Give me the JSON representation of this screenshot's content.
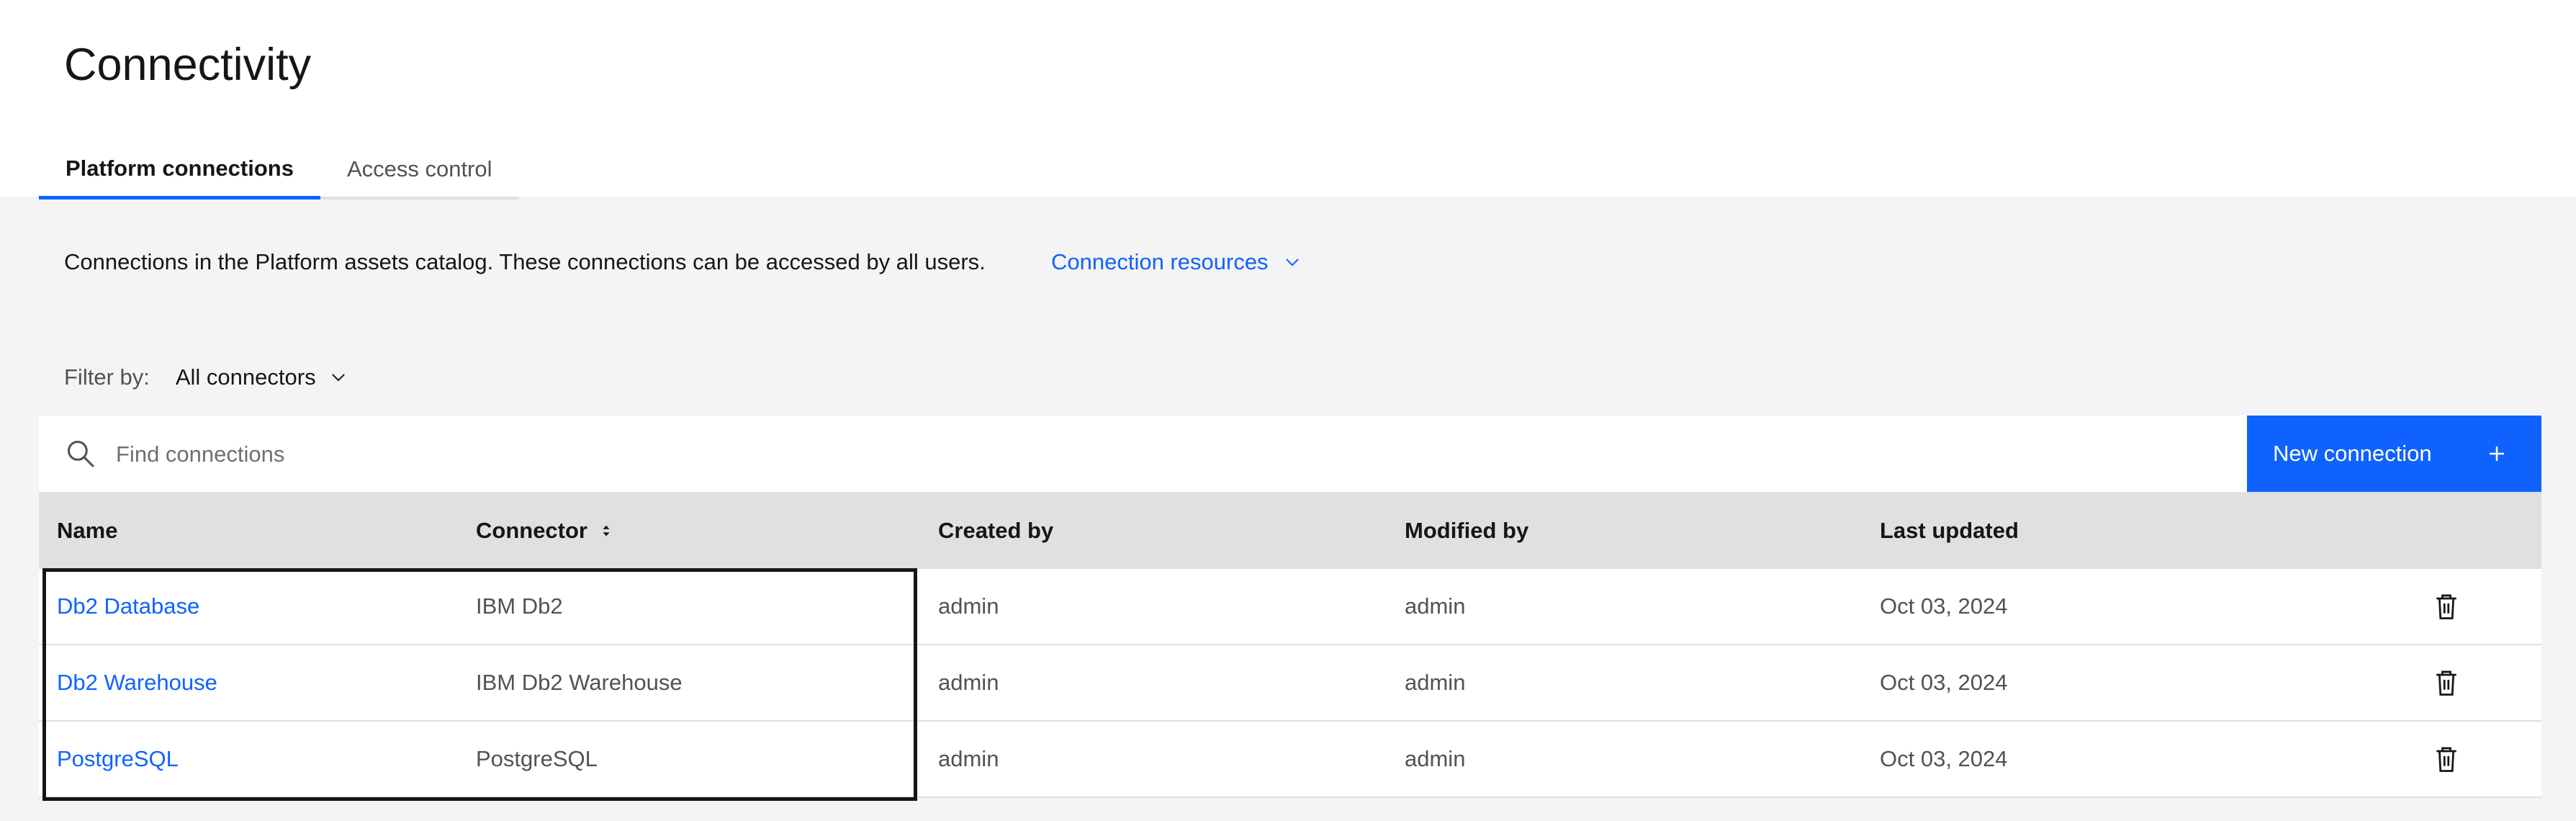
{
  "page": {
    "title": "Connectivity"
  },
  "tabs": [
    {
      "label": "Platform connections",
      "active": true
    },
    {
      "label": "Access control",
      "active": false
    }
  ],
  "description": "Connections in the Platform assets catalog. These connections can be accessed by all users.",
  "resources_link": {
    "label": "Connection resources",
    "icon": "chevron-down-icon"
  },
  "filter": {
    "label": "Filter by:",
    "value": "All connectors",
    "icon": "chevron-down-icon"
  },
  "search": {
    "placeholder": "Find connections",
    "value": "",
    "icon": "search-icon"
  },
  "new_button": {
    "label": "New connection",
    "icon": "plus-icon"
  },
  "table": {
    "columns": [
      "Name",
      "Connector",
      "Created by",
      "Modified by",
      "Last updated"
    ],
    "sortable_column": "Connector",
    "rows": [
      {
        "name": "Db2 Database",
        "connector": "IBM Db2",
        "created_by": "admin",
        "modified_by": "admin",
        "last_updated": "Oct 03, 2024"
      },
      {
        "name": "Db2 Warehouse",
        "connector": "IBM Db2 Warehouse",
        "created_by": "admin",
        "modified_by": "admin",
        "last_updated": "Oct 03, 2024"
      },
      {
        "name": "PostgreSQL",
        "connector": "PostgreSQL",
        "created_by": "admin",
        "modified_by": "admin",
        "last_updated": "Oct 03, 2024"
      }
    ],
    "row_action_icon": "trash-icon"
  },
  "colors": {
    "accent": "#0f62fe",
    "header_bg": "#e0e0e0",
    "page_bg": "#f4f4f4"
  }
}
